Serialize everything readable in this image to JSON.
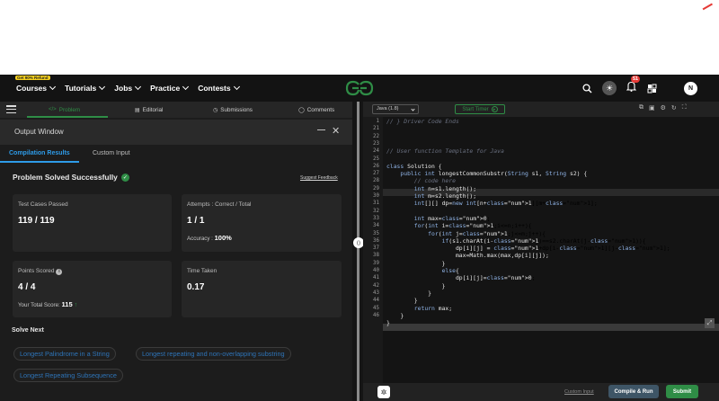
{
  "navbar": {
    "refund_badge": "Get 90% Refund",
    "items": [
      {
        "label": "Courses"
      },
      {
        "label": "Tutorials"
      },
      {
        "label": "Jobs"
      },
      {
        "label": "Practice"
      },
      {
        "label": "Contests"
      }
    ],
    "notification_count": "51",
    "avatar_initial": "N"
  },
  "problem_tabs": {
    "items": [
      {
        "label": "Problem",
        "icon": "code-icon"
      },
      {
        "label": "Editorial",
        "icon": "document-icon"
      },
      {
        "label": "Submissions",
        "icon": "clock-icon"
      },
      {
        "label": "Comments",
        "icon": "comment-icon"
      }
    ]
  },
  "output_window": {
    "title": "Output Window",
    "tabs": [
      "Compilation Results",
      "Custom Input"
    ],
    "status": "Problem Solved Successfully",
    "suggest_feedback": "Suggest Feedback",
    "cards": {
      "test_cases": {
        "label": "Test Cases Passed",
        "value": "119 / 119"
      },
      "attempts": {
        "label": "Attempts : Correct / Total",
        "value": "1 / 1",
        "sub_label": "Accuracy :",
        "sub_value": "100%"
      },
      "points": {
        "label": "Points Scored",
        "value": "4 / 4",
        "sub_label": "Your Total Score:",
        "sub_value": "115"
      },
      "time": {
        "label": "Time Taken",
        "value": "0.17"
      }
    },
    "solve_next": {
      "title": "Solve Next",
      "items": [
        "Longest Palindrome in a String",
        "Longest repeating and non-overlapping substring",
        "Longest Repeating Subsequence"
      ]
    }
  },
  "editor": {
    "language": "Java (1.8)",
    "timer_label": "Start Timer",
    "line_numbers": [
      "1",
      "21",
      "22",
      "23",
      "24",
      "25",
      "26",
      "27",
      "28",
      "29",
      "30",
      "31",
      "32",
      "33",
      "34",
      "35",
      "36",
      "37",
      "38",
      "39",
      "40",
      "41",
      "42",
      "43",
      "44",
      "45",
      "46"
    ],
    "code_lines": [
      "// } Driver Code Ends",
      "",
      "",
      "",
      "// User function Template for Java",
      "",
      "class Solution {",
      "    public int longestCommonSubstr(String s1, String s2) {",
      "        // code here",
      "        int n=s1.length();",
      "        int m=s2.length();",
      "        int[][] dp=new int[n+1][m+1];",
      "",
      "        int max=0;",
      "        for(int i=1;i<=n;i++){",
      "            for(int j=1;j<=m;j++){",
      "                if(s1.charAt(i-1)==s2.charAt(j-1)){",
      "                    dp[i][j] = 1+dp[i-1][j-1];",
      "                    max=Math.max(max,dp[i][j]);",
      "                }",
      "                else{",
      "                    dp[i][j]=0;",
      "                }",
      "            }",
      "        }",
      "        return max;",
      "    }",
      "}"
    ],
    "custom_input": "Custom Input",
    "compile_label": "Compile & Run",
    "submit_label": "Submit"
  }
}
